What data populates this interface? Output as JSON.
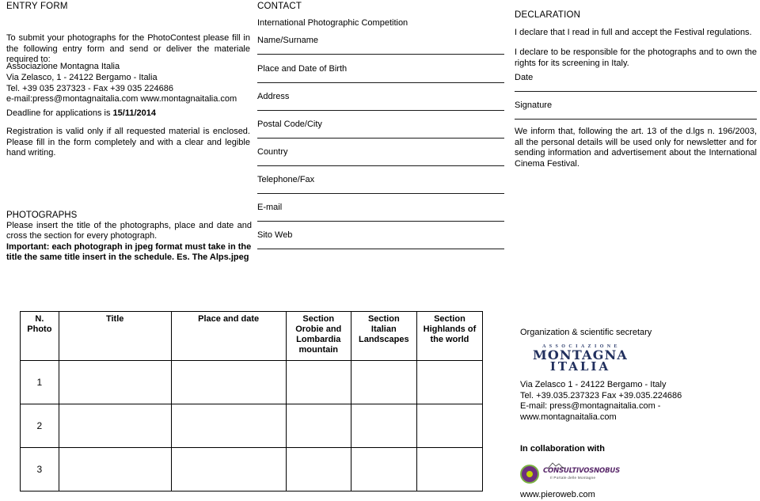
{
  "left": {
    "entry_form_title": "ENTRY FORM",
    "intro": "To submit your photographs for the PhotoContest please fill in the following entry form and send or deliver the materiale required to:",
    "association": [
      "Associazione Montagna Italia",
      "Via Zelasco, 1 - 24122 Bergamo - Italia",
      "Tel. +39 035 237323 - Fax +39 035 224686",
      "e-mail:press@montagnaitalia.com  www.montagnaitalia.com"
    ],
    "deadline_prefix": "Deadline for applications is ",
    "deadline_date": "15/11/2014",
    "rules": "Registration is valid only if all requested material is enclosed. Please fill in the form completely and with a clear and legible hand writing.",
    "photographs_title": "PHOTOGRAPHS",
    "photographs_desc": "Please insert the title of the photographs, place and date and cross the section for every photograph.",
    "photographs_important": "Important: each photograph in jpeg format must take in the title the same title insert in the schedule. Es. The Alps.jpeg"
  },
  "contact": {
    "title": "CONTACT",
    "competition": "International Photographic Competition",
    "fields": [
      {
        "label": "Name/Surname",
        "value": ""
      },
      {
        "label": "Place and Date of Birth",
        "value": ""
      },
      {
        "label": "Address",
        "value": ""
      },
      {
        "label": "Postal Code/City",
        "value": ""
      },
      {
        "label": "Country",
        "value": ""
      },
      {
        "label": "Telephone/Fax",
        "value": ""
      },
      {
        "label": "E-mail",
        "value": ""
      },
      {
        "label": "Sito Web",
        "value": ""
      }
    ]
  },
  "declaration": {
    "title": "DECLARATION",
    "statement_1": "I declare that I read in full and accept the Festival regulations.",
    "statement_2": "I declare  to be responsible for the photographs and to own the rights for its screening in Italy.",
    "date_label": "Date",
    "signature_label": "Signature",
    "privacy": "We inform that, following the art. 13 of the d.lgs n. 196/2003, all the personal details will be used only for newsletter and for sending information and advertisement about the  International Cinema Festival."
  },
  "table": {
    "headers": [
      "N.\nPhoto",
      "Title",
      "Place and date",
      "Section\nOrobie and\nLombardia\nmountain",
      "Section\nItalian\nLandscapes",
      "Section\nHighlands of\nthe world"
    ],
    "header_lines": {
      "num": [
        "N.",
        "Photo"
      ],
      "title": [
        "Title"
      ],
      "place": [
        "Place and date"
      ],
      "s1": [
        "Section",
        "Orobie and",
        "Lombardia",
        "mountain"
      ],
      "s2": [
        "Section",
        "Italian",
        "Landscapes"
      ],
      "s3": [
        "Section",
        "Highlands of",
        "the world"
      ]
    },
    "rows": [
      {
        "n": "1",
        "title": "",
        "place": "",
        "s1": "",
        "s2": "",
        "s3": ""
      },
      {
        "n": "2",
        "title": "",
        "place": "",
        "s1": "",
        "s2": "",
        "s3": ""
      },
      {
        "n": "3",
        "title": "",
        "place": "",
        "s1": "",
        "s2": "",
        "s3": ""
      }
    ]
  },
  "organization": {
    "label": "Organization & scientific secretary",
    "logo": {
      "top_word": "ASSOCIAZIONE",
      "main_word": "MONTAGNA",
      "sub_word": "ITALIA",
      "color": "#22305e"
    },
    "address": [
      "Via Zelasco 1 - 24122 Bergamo - Italy",
      "Tel. +39.035.237323  Fax +39.035.224686",
      "E-mail: press@montagnaitalia.com - www.montagnaitalia.com"
    ]
  },
  "collaboration": {
    "label": "In collaboration with",
    "logo_wordmark": "CONSULTIVOSNOBUS",
    "logo_tagline": "Il Portale delle Montagne",
    "url": "www.pieroweb.com"
  }
}
